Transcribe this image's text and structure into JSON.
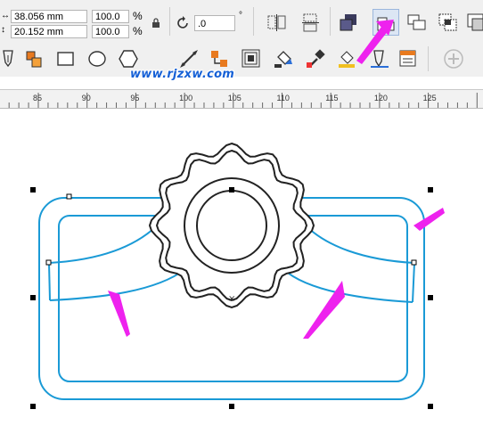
{
  "property_bar": {
    "width_value": "38.056 mm",
    "height_value": "20.152 mm",
    "scale_x": "100.0",
    "scale_y": "100.0",
    "percent_symbol": "%",
    "rotation_value": ".0"
  },
  "toolbar": {
    "text_tool_glyph": "字"
  },
  "watermark": "www.rjzxw.com",
  "ruler": {
    "ticks": [
      "85",
      "90",
      "95",
      "100",
      "105",
      "110",
      "115",
      "120",
      "125"
    ]
  },
  "colors": {
    "shape_stroke": "#1a9ad6",
    "badge_stroke": "#222222",
    "arrow": "#ee22ee"
  },
  "icons": [
    "lock-icon",
    "rotate-icon",
    "mirror-horizontal-icon",
    "mirror-vertical-icon",
    "arrange-front-icon",
    "weld-icon",
    "trim-icon",
    "intersect-icon",
    "simplify-icon",
    "pen-icon",
    "fill-icon",
    "rectangle-icon",
    "ellipse-icon",
    "polygon-icon",
    "dimension-icon",
    "connector-icon",
    "contour-icon",
    "eyedropper-icon",
    "outline-pen-icon",
    "plus-icon"
  ]
}
